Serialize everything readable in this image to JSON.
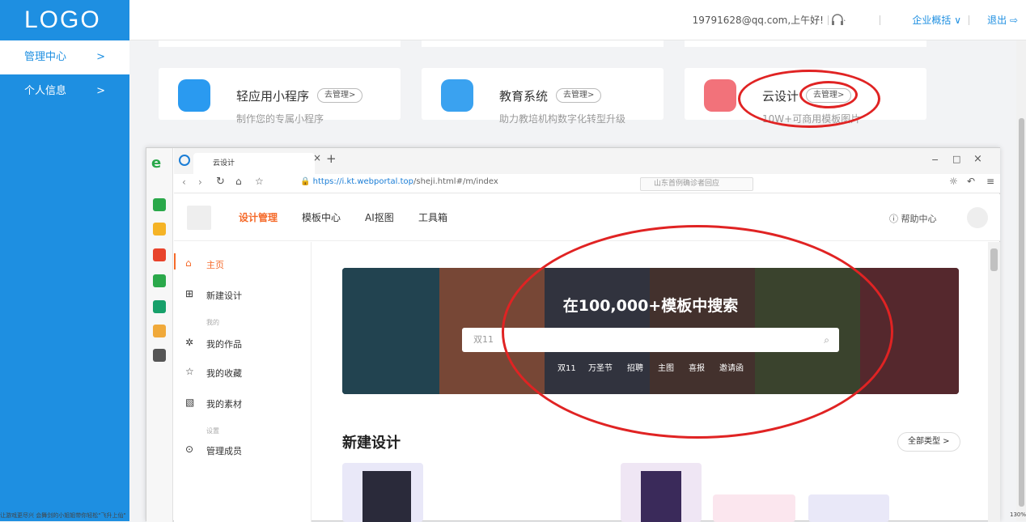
{
  "sidebar": {
    "logo": "LOGO",
    "items": [
      {
        "label": "管理中心",
        "chev": ">"
      },
      {
        "label": "个人信息",
        "chev": ">"
      }
    ]
  },
  "header": {
    "user": "19791628@qq.com,上午好!",
    "headset_icon": "headset-icon",
    "org": "企业概括 ∨",
    "exit": "退出"
  },
  "cards": [
    {
      "title": "轻应用小程序",
      "manage": "去管理>",
      "desc": "制作您的专属小程序",
      "icon_color": "#2a9af0"
    },
    {
      "title": "教育系统",
      "manage": "去管理>",
      "desc": "助力教培机构数字化转型升级",
      "icon_color": "#3aa2f0"
    },
    {
      "title": "云设计",
      "manage": "去管理>",
      "desc": "10W+可商用模板图片",
      "icon_color": "#f2727a"
    }
  ],
  "browser": {
    "tab_title": "云设计",
    "tab_close": "×",
    "new_tab": "+",
    "url_host": "https://i.kt.webportal.top",
    "url_path": "/sheji.html#/m/index",
    "search_placeholder": "山东首例确诊者回应",
    "window_controls": [
      "−",
      "□",
      "×"
    ]
  },
  "app": {
    "nav": [
      "设计管理",
      "模板中心",
      "AI抠图",
      "工具箱"
    ],
    "help": "帮助中心",
    "menu": {
      "home": "主页",
      "new_design": "新建设计",
      "group_mine": "我的",
      "works": "我的作品",
      "favorites": "我的收藏",
      "materials": "我的素材",
      "group_settings": "设置",
      "members": "管理成员"
    },
    "banner": {
      "title": "在100,000+模板中搜索",
      "search_value": "双11",
      "tags": [
        "双11",
        "万圣节",
        "招聘",
        "主图",
        "喜报",
        "邀请函"
      ]
    },
    "section_title": "新建设计",
    "all_types": "全部类型 >"
  },
  "status": {
    "left": "让游戏更尽兴 会舞剑的小姐姐带你轻松\"飞升上仙\"",
    "zoom": "130%"
  },
  "colors": {
    "accent": "#1e8fe1",
    "design_accent": "#f56a2a",
    "annotation": "#e02323"
  }
}
